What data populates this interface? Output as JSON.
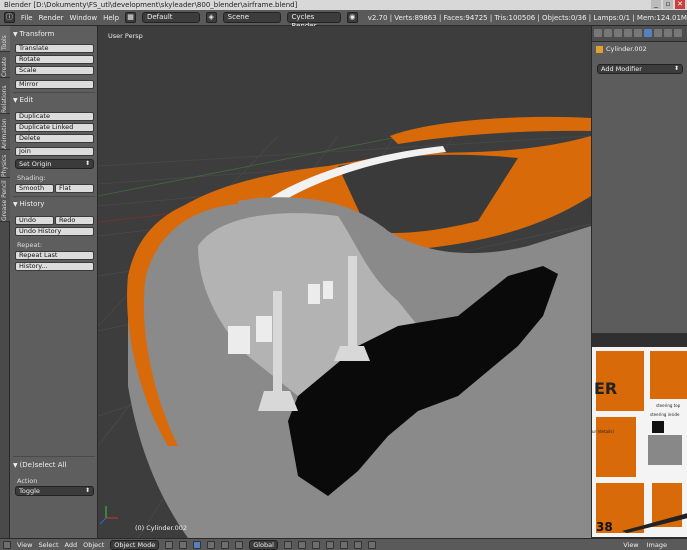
{
  "window": {
    "title": "Blender [D:\\Dokumenty\\FS_utl\\development\\skyleader\\800_blender\\airframe.blend]",
    "buttons": [
      "_",
      "▫",
      "✕"
    ]
  },
  "topbar": {
    "menus": [
      "File",
      "Render",
      "Window",
      "Help"
    ],
    "layout": "Default",
    "scene": "Scene",
    "engine": "Cycles Render",
    "stats": "v2.70 | Verts:89863 | Faces:94725 | Tris:100506 | Objects:0/36 | Lamps:0/1 | Mem:124.01M"
  },
  "vtabs": [
    "Tools",
    "Create",
    "Relations",
    "Animation",
    "Physics",
    "Grease Pencil"
  ],
  "toolshelf": {
    "transform": {
      "title": "Transform",
      "buttons": [
        "Translate",
        "Rotate",
        "Scale"
      ],
      "mirror": "Mirror"
    },
    "edit": {
      "title": "Edit",
      "buttons": [
        "Duplicate",
        "Duplicate Linked",
        "Delete"
      ],
      "join": "Join",
      "set_origin": "Set Origin",
      "shading_label": "Shading:",
      "smooth": "Smooth",
      "flat": "Flat"
    },
    "history": {
      "title": "History",
      "undo": "Undo",
      "redo": "Redo",
      "undo_history": "Undo History",
      "repeat_label": "Repeat:",
      "repeat_last": "Repeat Last",
      "history_btn": "History..."
    },
    "operator": {
      "title": "(De)select All",
      "action_label": "Action",
      "action_value": "Toggle"
    }
  },
  "viewport": {
    "label": "User Persp",
    "object_label": "(0) Cylinder.002"
  },
  "properties": {
    "object_name": "Cylinder.002",
    "add_modifier": "Add Modifier"
  },
  "image_editor": {
    "big_text": "ER",
    "label_steering_top": "steering top",
    "label_steering_inside": "steering inside",
    "label_details": "ur (details)",
    "number": "38"
  },
  "bottombar": {
    "menus": [
      "View",
      "Select",
      "Add",
      "Object"
    ],
    "mode": "Object Mode",
    "orientation": "Global",
    "right_menus": [
      "View",
      "Image"
    ]
  },
  "colors": {
    "orange": "#d96a0a",
    "body_grey": "#8a8a8a",
    "black_panel": "#0a0a0a"
  }
}
